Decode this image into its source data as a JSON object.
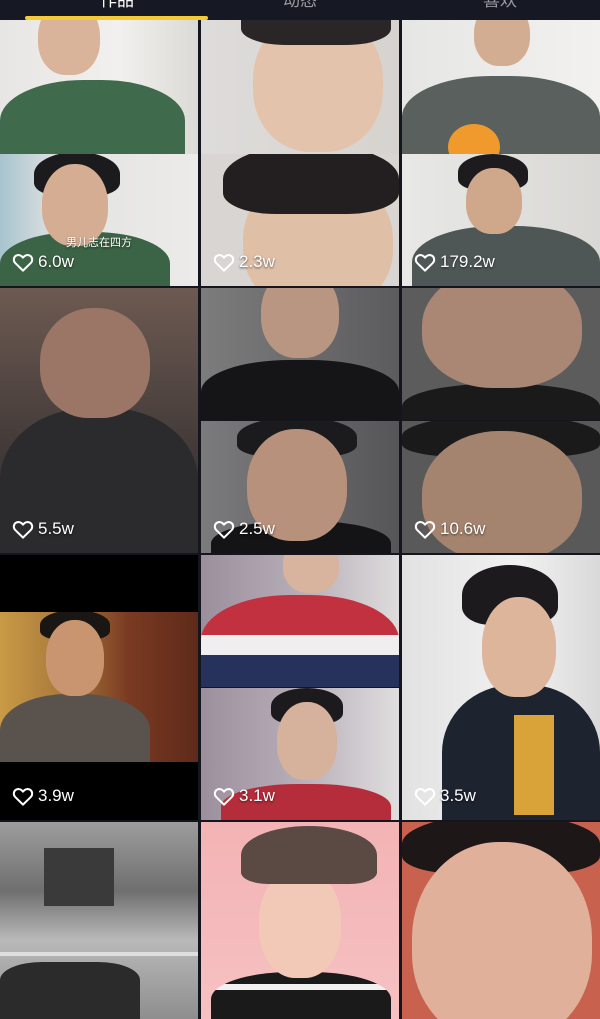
{
  "tabs": [
    {
      "label": "作品",
      "active": true
    },
    {
      "label": "动态",
      "active": false
    },
    {
      "label": "喜欢",
      "active": false
    }
  ],
  "colors": {
    "background": "#15151d",
    "tab_indicator": "#f4ca35",
    "like_text": "#ffffff"
  },
  "icons": {
    "like": "heart-outline-icon"
  },
  "videos": [
    {
      "likes": "6.0w",
      "caption": "男儿志在四方"
    },
    {
      "likes": "2.3w"
    },
    {
      "likes": "179.2w"
    },
    {
      "likes": "5.5w"
    },
    {
      "likes": "2.5w"
    },
    {
      "likes": "10.6w"
    },
    {
      "likes": "3.9w"
    },
    {
      "likes": "3.1w"
    },
    {
      "likes": "3.5w"
    },
    {},
    {},
    {}
  ]
}
